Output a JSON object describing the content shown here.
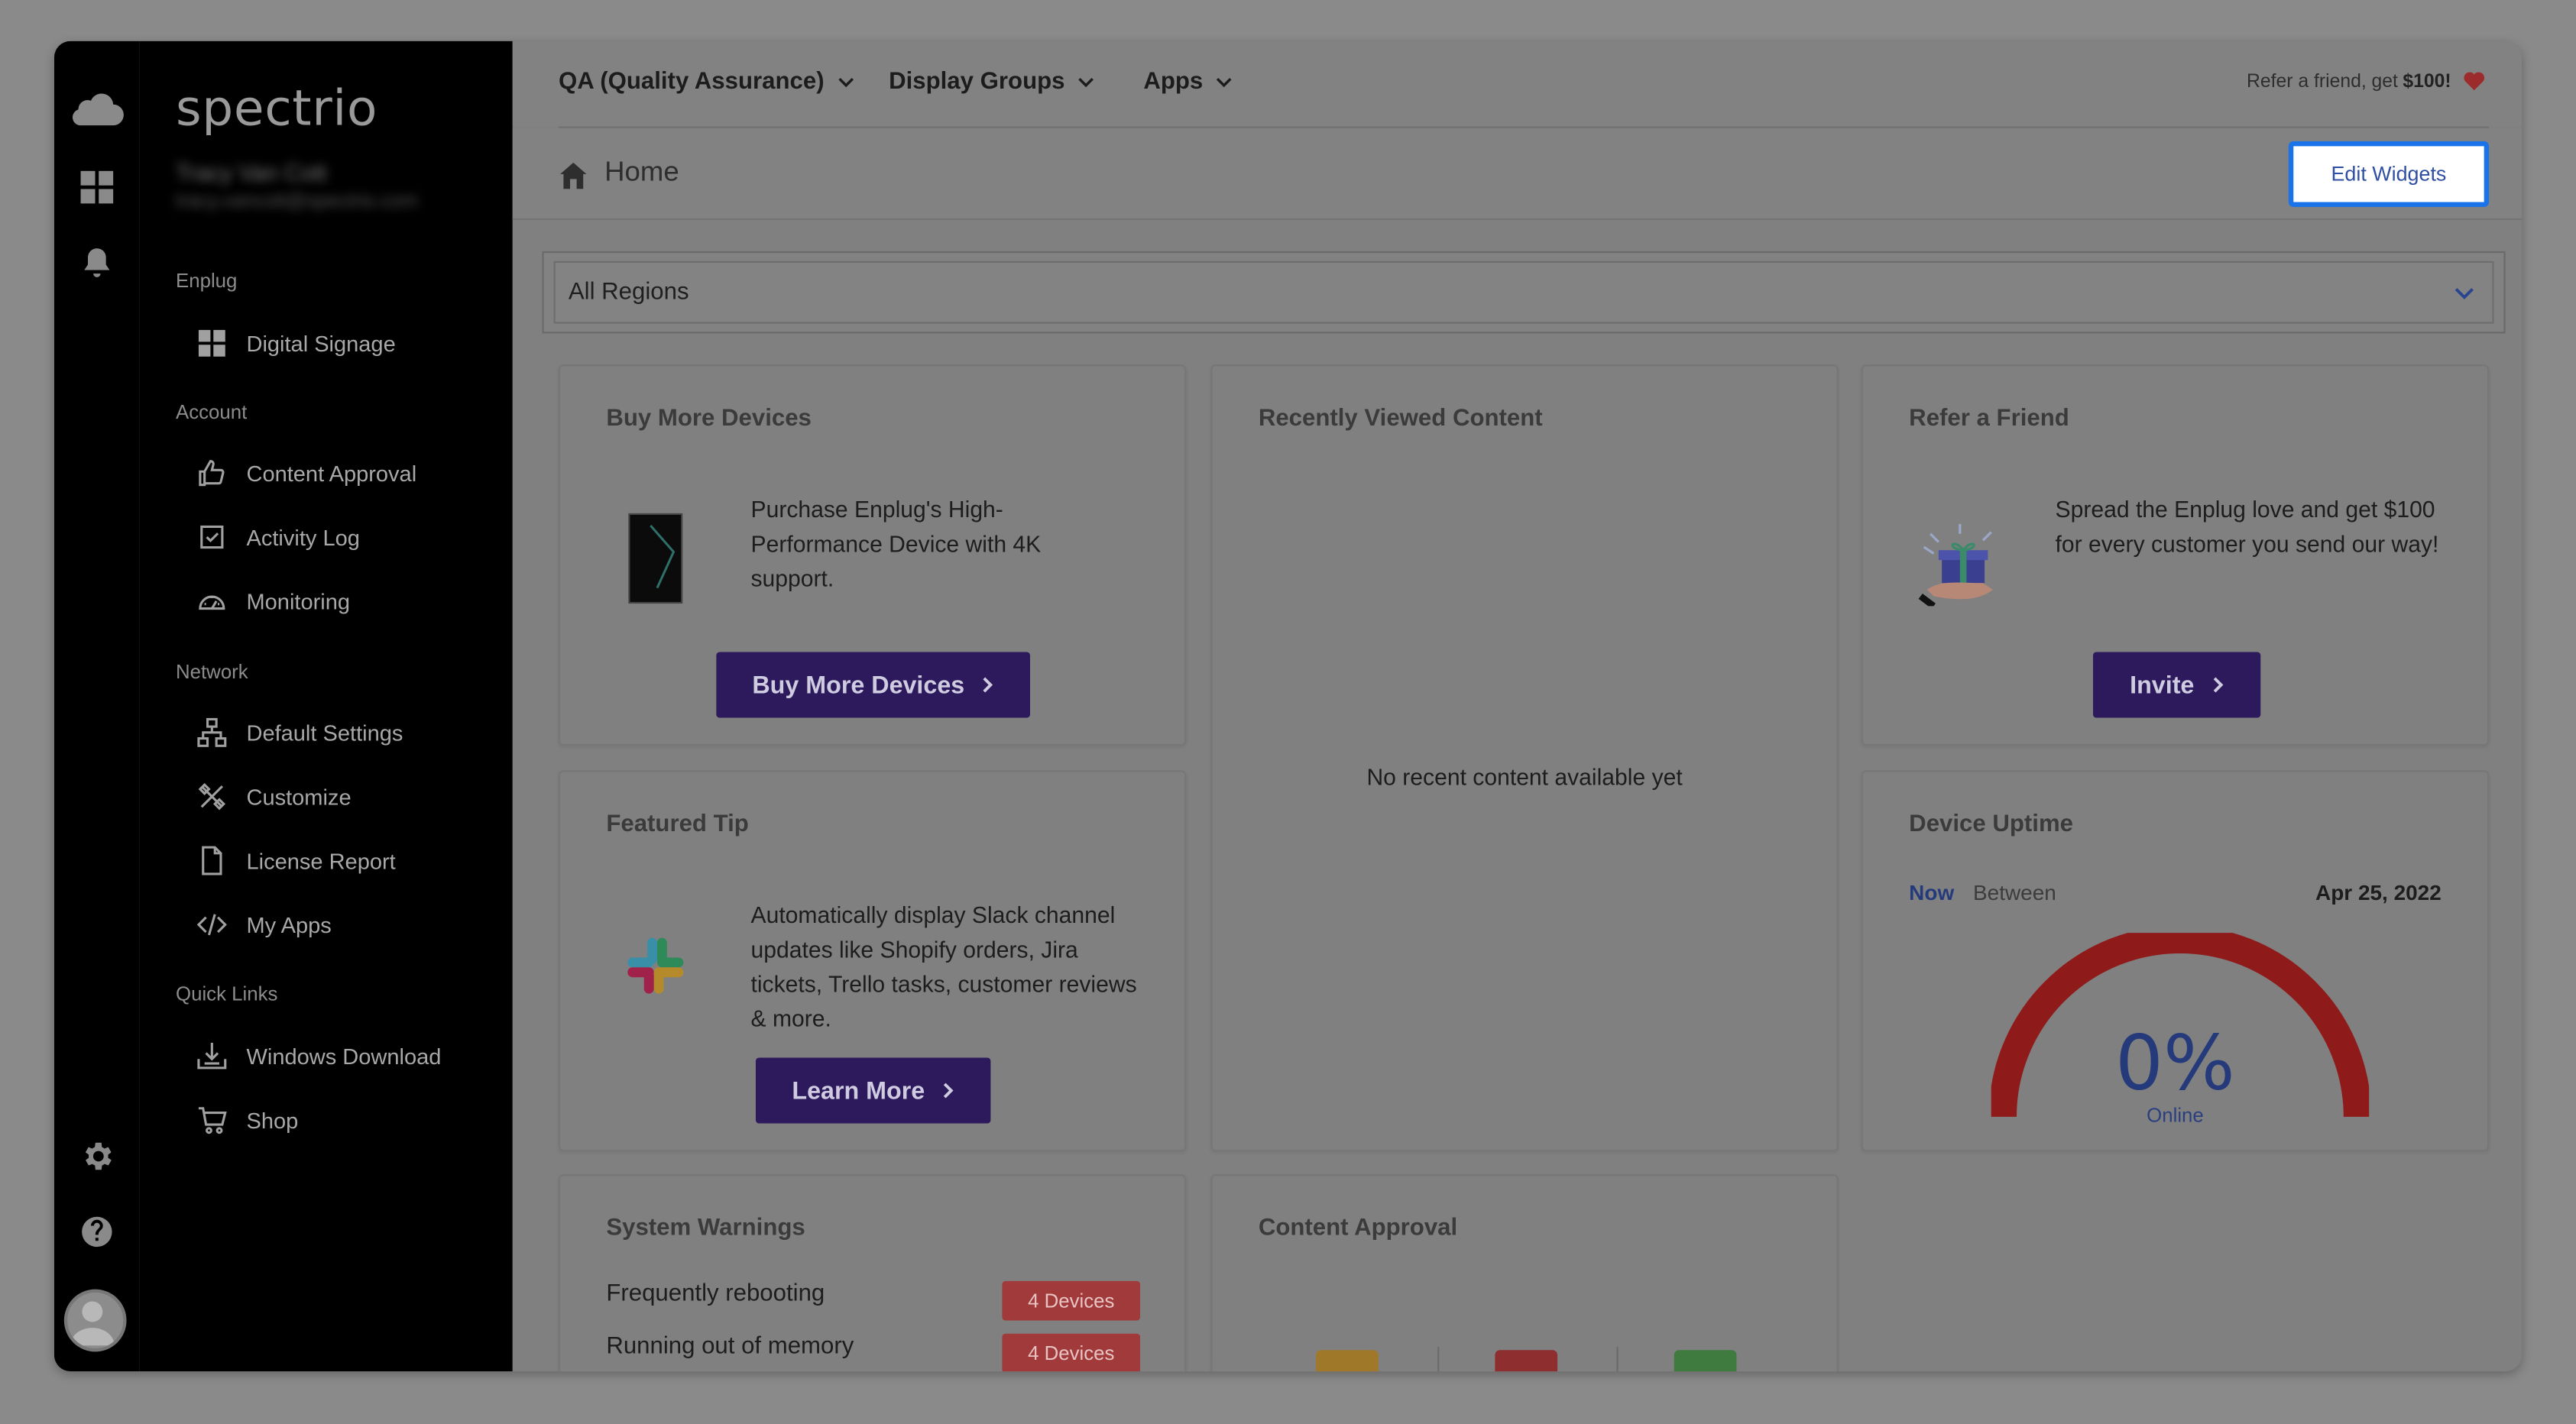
{
  "app": {
    "brand": "spectrio"
  },
  "user": {
    "name": "Tracy Van Cott",
    "email": "tracy.vancott@spectrio.com"
  },
  "sidebar": {
    "sections": [
      {
        "label": "Enplug",
        "items": [
          {
            "label": "Digital Signage",
            "icon": "grid-icon"
          }
        ]
      },
      {
        "label": "Account",
        "items": [
          {
            "label": "Content Approval",
            "icon": "thumbs-up-icon"
          },
          {
            "label": "Activity Log",
            "icon": "checkbox-icon"
          },
          {
            "label": "Monitoring",
            "icon": "speedometer-icon"
          }
        ]
      },
      {
        "label": "Network",
        "items": [
          {
            "label": "Default Settings",
            "icon": "network-icon"
          },
          {
            "label": "Customize",
            "icon": "tools-icon"
          },
          {
            "label": "License Report",
            "icon": "document-icon"
          },
          {
            "label": "My Apps",
            "icon": "code-icon"
          }
        ]
      },
      {
        "label": "Quick Links",
        "items": [
          {
            "label": "Windows Download",
            "icon": "download-icon"
          },
          {
            "label": "Shop",
            "icon": "cart-icon"
          }
        ]
      }
    ]
  },
  "topbar": {
    "menus": [
      "QA (Quality Assurance)",
      "Display Groups",
      "Apps"
    ],
    "refer_text": "Refer a friend, get",
    "refer_amount": "$100!"
  },
  "header": {
    "title": "Home",
    "edit_widgets": "Edit Widgets"
  },
  "region": {
    "selected": "All Regions"
  },
  "widgets": {
    "buy_devices": {
      "title": "Buy More Devices",
      "text": "Purchase Enplug's High-Performance Device with 4K support.",
      "button": "Buy More Devices"
    },
    "recent": {
      "title": "Recently Viewed Content",
      "empty": "No recent content available yet"
    },
    "refer": {
      "title": "Refer a Friend",
      "text": "Spread the Enplug love and get $100 for every customer you send our way!",
      "button": "Invite"
    },
    "tip": {
      "title": "Featured Tip",
      "text": "Automatically display Slack channel updates like Shopify orders, Jira tickets, Trello tasks, customer reviews & more.",
      "button": "Learn More"
    },
    "uptime": {
      "title": "Device Uptime",
      "tab_now": "Now",
      "tab_between": "Between",
      "date": "Apr 25, 2022",
      "value": "0%",
      "label": "Online",
      "online_fraction": 0
    },
    "warnings": {
      "title": "System Warnings",
      "rows": [
        {
          "label": "Frequently rebooting",
          "badge": "4 Devices"
        },
        {
          "label": "Running out of memory",
          "badge": "4 Devices"
        }
      ]
    },
    "approval": {
      "title": "Content Approval"
    }
  },
  "colors": {
    "primary_button": "#2c1a5c",
    "accent": "#1a73e8",
    "gauge": "#8f1a1a",
    "warning_badge": "#a13a3a"
  }
}
